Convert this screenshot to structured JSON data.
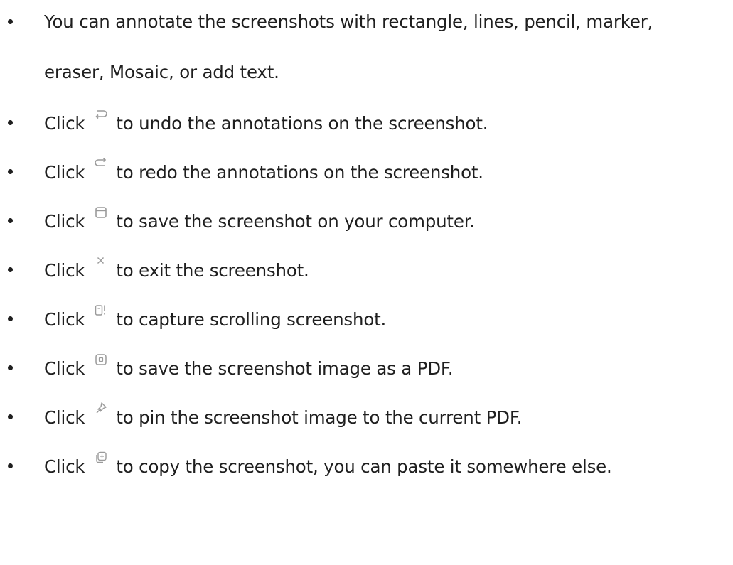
{
  "items": [
    {
      "line1": "You can annotate the screenshots with rectangle, lines, pencil, marker,",
      "line2": "eraser, Mosaic, or add text."
    },
    {
      "prefix": "Click",
      "icon": "undo-icon",
      "text": "to undo the annotations on the screenshot."
    },
    {
      "prefix": "Click",
      "icon": "redo-icon",
      "text": "to redo the annotations on the screenshot."
    },
    {
      "prefix": "Click",
      "icon": "save-icon",
      "text": "to save the screenshot on your computer."
    },
    {
      "prefix": "Click",
      "icon": "close-icon",
      "text": "to exit the screenshot."
    },
    {
      "prefix": "Click",
      "icon": "scroll-capture-icon",
      "text": "to capture scrolling screenshot."
    },
    {
      "prefix": "Click",
      "icon": "save-as-pdf-icon",
      "text": "to save the screenshot image as a PDF."
    },
    {
      "prefix": "Click",
      "icon": "pin-icon",
      "text": "to pin the screenshot image to the current PDF."
    },
    {
      "prefix": "Click",
      "icon": "copy-icon",
      "text": "to copy the screenshot, you can paste it somewhere else."
    }
  ],
  "colors": {
    "text": "#1f1f1f",
    "icon": "#9a9a9a"
  }
}
